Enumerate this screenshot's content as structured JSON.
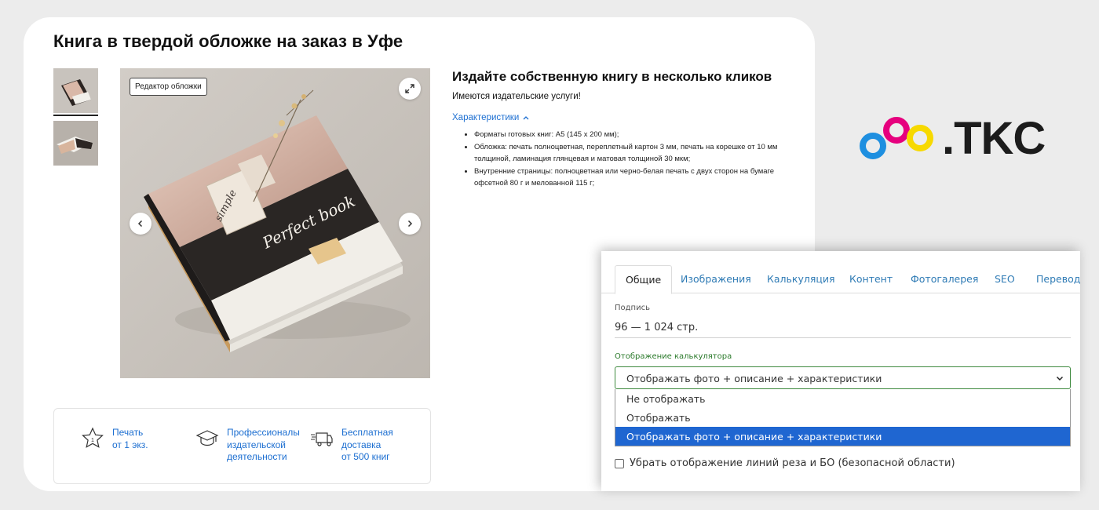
{
  "product": {
    "title": "Книга в твердой обложке на заказ в Уфе",
    "editor_badge": "Редактор обложки",
    "cover_script_title": "Perfect book",
    "cover_tag_word": "simple"
  },
  "info": {
    "heading": "Издайте собственную книгу в несколько кликов",
    "subheading": "Имеются издательские услуги!",
    "specs_toggle": "Характеристики",
    "specs": [
      "Форматы готовых книг: А5 (145 х 200 мм);",
      "Обложка: печать полноцветная, переплетный картон 3 мм, печать на корешке от 10 мм толщиной, ламинация глянцевая и матовая толщиной 30 мкм;",
      "Внутренние страницы: полноцветная или черно-белая печать с двух сторон на бумаге офсетной 80 г и мелованной 115 г;"
    ]
  },
  "features": [
    {
      "icon": "star-icon",
      "badge": "1",
      "lines": [
        "Печать",
        "от 1 экз."
      ]
    },
    {
      "icon": "graduation-cap-icon",
      "lines": [
        "Профессионалы",
        "издательской",
        "деятельности"
      ]
    },
    {
      "icon": "delivery-truck-icon",
      "lines": [
        "Бесплатная",
        "доставка",
        "от 500 книг"
      ]
    }
  ],
  "logo": {
    "text": ".TKC",
    "colors": {
      "blue": "#1e8fe0",
      "magenta": "#e6007e",
      "yellow": "#f7d900"
    }
  },
  "admin": {
    "tabs": [
      "Общие",
      "Изображения",
      "Калькуляция",
      "Контент",
      "Фотогалерея",
      "SEO",
      "Перевод"
    ],
    "active_tab": "Общие",
    "signature_label": "Подпись",
    "signature_value": "96 — 1 024 стр.",
    "calc_label": "Отображение калькулятора",
    "calc_selected": "Отображать фото + описание + характеристики",
    "calc_options": [
      "Не отображать",
      "Отображать",
      "Отображать фото + описание + характеристики"
    ],
    "checkbox_label": "Убрать отображение линий реза и БО (безопасной области)",
    "checkbox_checked": false
  },
  "colors": {
    "link": "#1d6fd1",
    "select_highlight": "#1f66d1",
    "admin_tab": "#2f7bb5",
    "valid_green": "#2b7a2b"
  }
}
